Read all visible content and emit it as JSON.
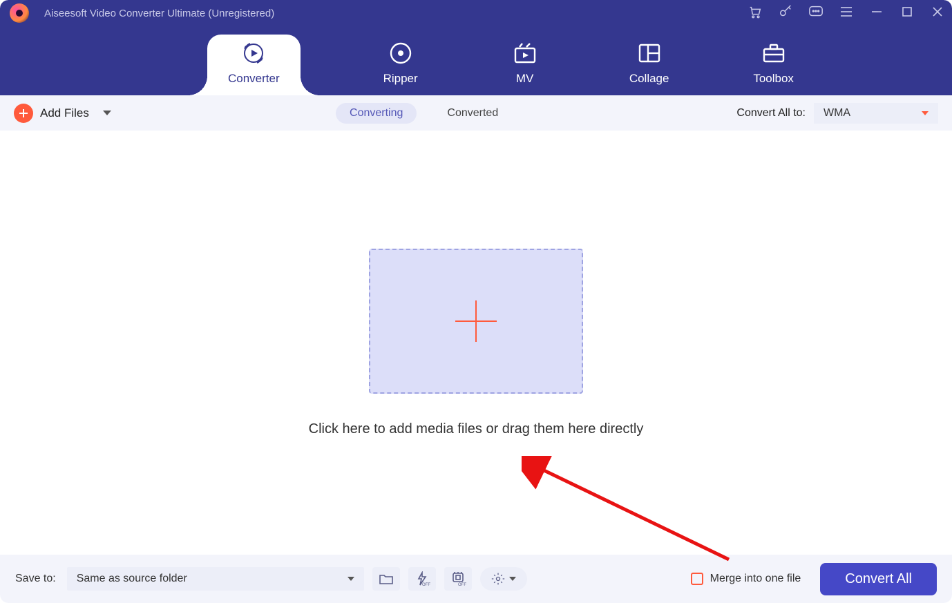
{
  "app": {
    "title": "Aiseesoft Video Converter Ultimate (Unregistered)"
  },
  "tabs": [
    {
      "label": "Converter",
      "icon": "converter-icon",
      "active": true
    },
    {
      "label": "Ripper",
      "icon": "ripper-icon",
      "active": false
    },
    {
      "label": "MV",
      "icon": "mv-icon",
      "active": false
    },
    {
      "label": "Collage",
      "icon": "collage-icon",
      "active": false
    },
    {
      "label": "Toolbox",
      "icon": "toolbox-icon",
      "active": false
    }
  ],
  "toolbar": {
    "add_files_label": "Add Files",
    "segments": {
      "converting": "Converting",
      "converted": "Converted",
      "active": "converting"
    },
    "convert_all_to_label": "Convert All to:",
    "convert_all_to_value": "WMA"
  },
  "dropzone": {
    "hint": "Click here to add media files or drag them here directly"
  },
  "footer": {
    "save_to_label": "Save to:",
    "save_to_value": "Same as source folder",
    "merge_label": "Merge into one file",
    "merge_checked": false,
    "convert_button_label": "Convert All"
  },
  "icons": {
    "cart": "cart-icon",
    "key": "key-icon",
    "feedback": "feedback-icon",
    "menu": "menu-icon",
    "min": "minimize-icon",
    "max": "maximize-icon",
    "close": "close-icon"
  }
}
